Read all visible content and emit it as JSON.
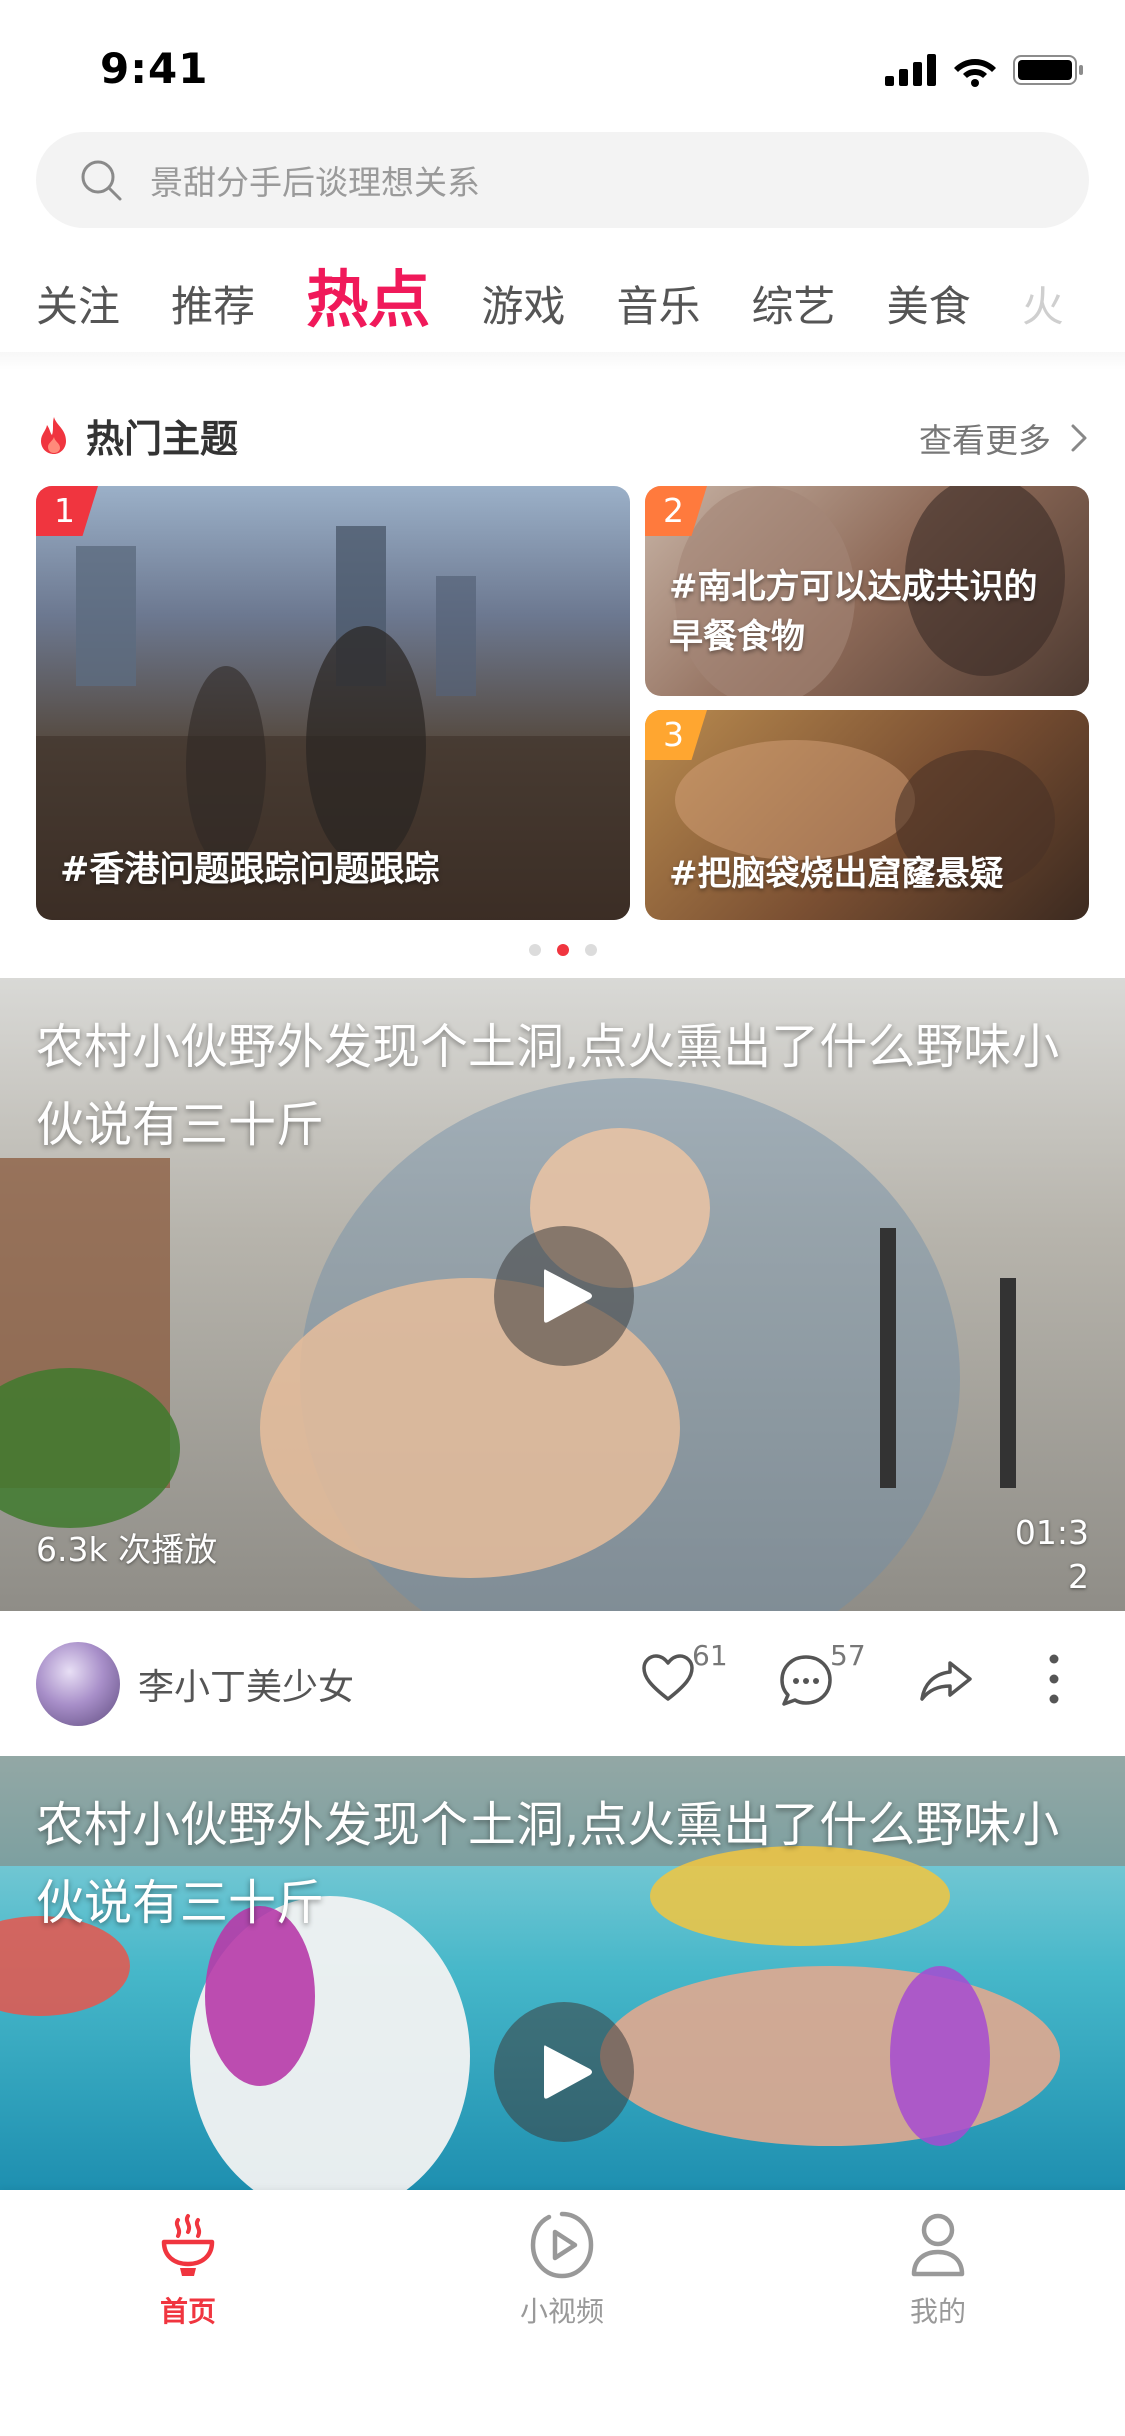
{
  "status_bar": {
    "time": "9:41"
  },
  "search": {
    "placeholder": "景甜分手后谈理想关系"
  },
  "tabs": [
    {
      "label": "关注"
    },
    {
      "label": "推荐"
    },
    {
      "label": "热点"
    },
    {
      "label": "游戏"
    },
    {
      "label": "音乐"
    },
    {
      "label": "综艺"
    },
    {
      "label": "美食"
    },
    {
      "label": "火"
    }
  ],
  "hot_topics": {
    "title": "热门主题",
    "more": "查看更多",
    "cards": [
      {
        "rank": "1",
        "caption": "#香港问题跟踪问题跟踪"
      },
      {
        "rank": "2",
        "caption": "#南北方可以达成共识的早餐食物"
      },
      {
        "rank": "3",
        "caption": "#把脑袋烧出窟窿悬疑"
      }
    ]
  },
  "feed": [
    {
      "title": "农村小伙野外发现个土洞,点火熏出了什么野味小伙说有三十斤",
      "views": "6.3k 次播放",
      "duration": "01:32",
      "author": "李小丁美少女",
      "likes": "61",
      "comments": "57"
    },
    {
      "title": "农村小伙野外发现个土洞,点火熏出了什么野味小伙说有三十斤"
    }
  ],
  "bottom_nav": [
    {
      "label": "首页",
      "icon": "home-fire-icon",
      "active": true
    },
    {
      "label": "小视频",
      "icon": "play-icon",
      "active": false
    },
    {
      "label": "我的",
      "icon": "user-icon",
      "active": false
    }
  ],
  "colors": {
    "accent": "#f0195a",
    "rank1": "#f0353f",
    "rank2": "#ff7a3d",
    "rank3": "#ffa630"
  }
}
